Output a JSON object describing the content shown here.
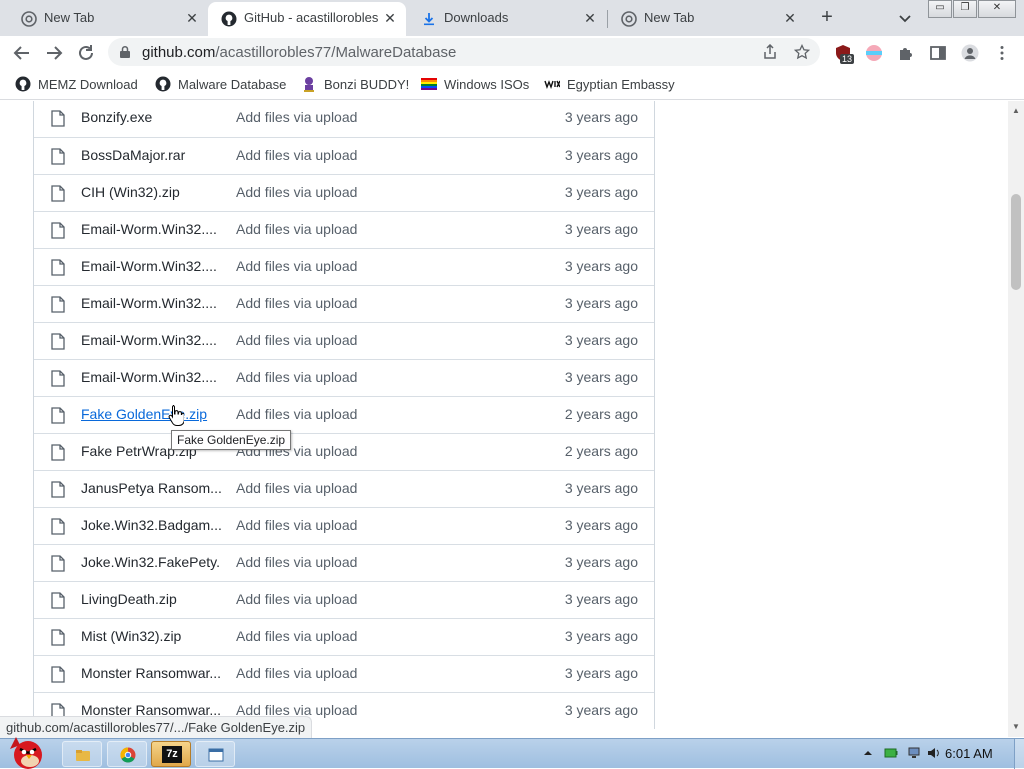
{
  "browser": {
    "tabs": [
      {
        "title": "New Tab",
        "active": false
      },
      {
        "title": "GitHub - acastillorobles",
        "active": true
      },
      {
        "title": "Downloads",
        "active": false
      },
      {
        "title": "New Tab",
        "active": false
      }
    ],
    "new_tab_label": "+",
    "url_host": "github.com",
    "url_path": "/acastillorobles77/MalwareDatabase",
    "extension_badge": "13",
    "window_controls": {
      "minimize": "▭",
      "restore": "❐",
      "close": "✕"
    }
  },
  "bookmarks": [
    {
      "label": "MEMZ Download",
      "icon": "github-icon"
    },
    {
      "label": "Malware Database",
      "icon": "github-icon"
    },
    {
      "label": "Bonzi BUDDY!",
      "icon": "bonzi-icon"
    },
    {
      "label": "Windows ISOs",
      "icon": "rainbow-flag-icon"
    },
    {
      "label": "Egyptian Embassy",
      "icon": "wix-icon"
    }
  ],
  "files": [
    {
      "name": "Bonzify.exe",
      "commit": "Add files via upload",
      "age": "3 years ago"
    },
    {
      "name": "BossDaMajor.rar",
      "commit": "Add files via upload",
      "age": "3 years ago"
    },
    {
      "name": "CIH (Win32).zip",
      "commit": "Add files via upload",
      "age": "3 years ago"
    },
    {
      "name": "Email-Worm.Win32....",
      "commit": "Add files via upload",
      "age": "3 years ago"
    },
    {
      "name": "Email-Worm.Win32....",
      "commit": "Add files via upload",
      "age": "3 years ago"
    },
    {
      "name": "Email-Worm.Win32....",
      "commit": "Add files via upload",
      "age": "3 years ago"
    },
    {
      "name": "Email-Worm.Win32....",
      "commit": "Add files via upload",
      "age": "3 years ago"
    },
    {
      "name": "Email-Worm.Win32....",
      "commit": "Add files via upload",
      "age": "3 years ago"
    },
    {
      "name": "Fake GoldenEye.zip",
      "commit": "Add files via upload",
      "age": "2 years ago",
      "hovered": true
    },
    {
      "name": "Fake PetrWrap.zip",
      "commit": "Add files via upload",
      "age": "2 years ago"
    },
    {
      "name": "JanusPetya Ransom...",
      "commit": "Add files via upload",
      "age": "3 years ago"
    },
    {
      "name": "Joke.Win32.Badgam...",
      "commit": "Add files via upload",
      "age": "3 years ago"
    },
    {
      "name": "Joke.Win32.FakePety...",
      "commit": "Add files via upload",
      "age": "3 years ago"
    },
    {
      "name": "LivingDeath.zip",
      "commit": "Add files via upload",
      "age": "3 years ago"
    },
    {
      "name": "Mist (Win32).zip",
      "commit": "Add files via upload",
      "age": "3 years ago"
    },
    {
      "name": "Monster Ransomwar...",
      "commit": "Add files via upload",
      "age": "3 years ago"
    },
    {
      "name": "Monster Ransomwar...",
      "commit": "Add files via upload",
      "age": "3 years ago"
    }
  ],
  "tooltip": "Fake GoldenEye.zip",
  "status_url": "github.com/acastillorobles77/.../Fake GoldenEye.zip",
  "taskbar": {
    "clock": "6:01 AM",
    "zip_label": "7z"
  },
  "colors": {
    "link": "#0969da",
    "tab_strip": "#dee1e6",
    "taskbar": "#b9d1ea"
  }
}
